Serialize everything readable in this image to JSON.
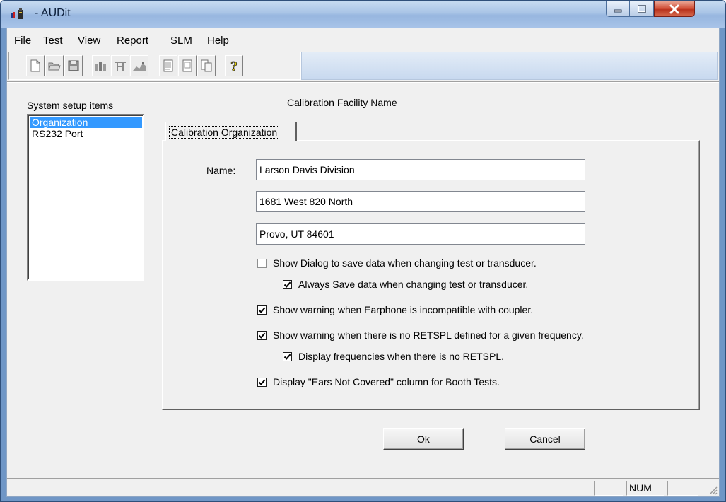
{
  "window": {
    "title": "- AUDit"
  },
  "menu": [
    {
      "underline": "F",
      "rest": "ile"
    },
    {
      "underline": "T",
      "rest": "est"
    },
    {
      "underline": "V",
      "rest": "iew"
    },
    {
      "underline": "R",
      "rest": "eport"
    },
    {
      "underline": "",
      "rest": "SLM"
    },
    {
      "underline": "H",
      "rest": "elp"
    }
  ],
  "toolbar": {
    "icons": [
      "new-file-icon",
      "open-folder-icon",
      "save-disk-icon",
      "meter-icon",
      "transducer-icon",
      "chart-icon",
      "report-icon",
      "report-view-icon",
      "report-print-icon",
      "help-icon"
    ]
  },
  "sidebar": {
    "label": "System setup items",
    "items": [
      {
        "label": "Organization",
        "selected": true
      },
      {
        "label": "RS232 Port",
        "selected": false
      }
    ]
  },
  "main": {
    "heading": "Calibration Facility Name",
    "tab_label": "Calibration Organization",
    "name_label": "Name:",
    "fields": {
      "line1": "Larson Davis Division",
      "line2": "1681 West 820 North",
      "line3": "Provo, UT 84601"
    },
    "checks": [
      {
        "label": "Show Dialog to save data when changing test or transducer.",
        "checked": false
      },
      {
        "label": "Always Save data when changing test or transducer.",
        "checked": true
      },
      {
        "label": "Show warning when Earphone is incompatible with coupler.",
        "checked": true
      },
      {
        "label": "Show warning when there is no RETSPL defined for a given frequency.",
        "checked": true
      },
      {
        "label": "Display frequencies when there is no RETSPL.",
        "checked": true
      },
      {
        "label": "Display \"Ears Not Covered\" column for Booth Tests.",
        "checked": true
      }
    ],
    "ok_label": "Ok",
    "cancel_label": "Cancel"
  },
  "statusbar": {
    "num": "NUM"
  },
  "colors": {
    "selection": "#3399ff",
    "titlebar": "#a9c4e6",
    "close": "#cf4b33"
  }
}
